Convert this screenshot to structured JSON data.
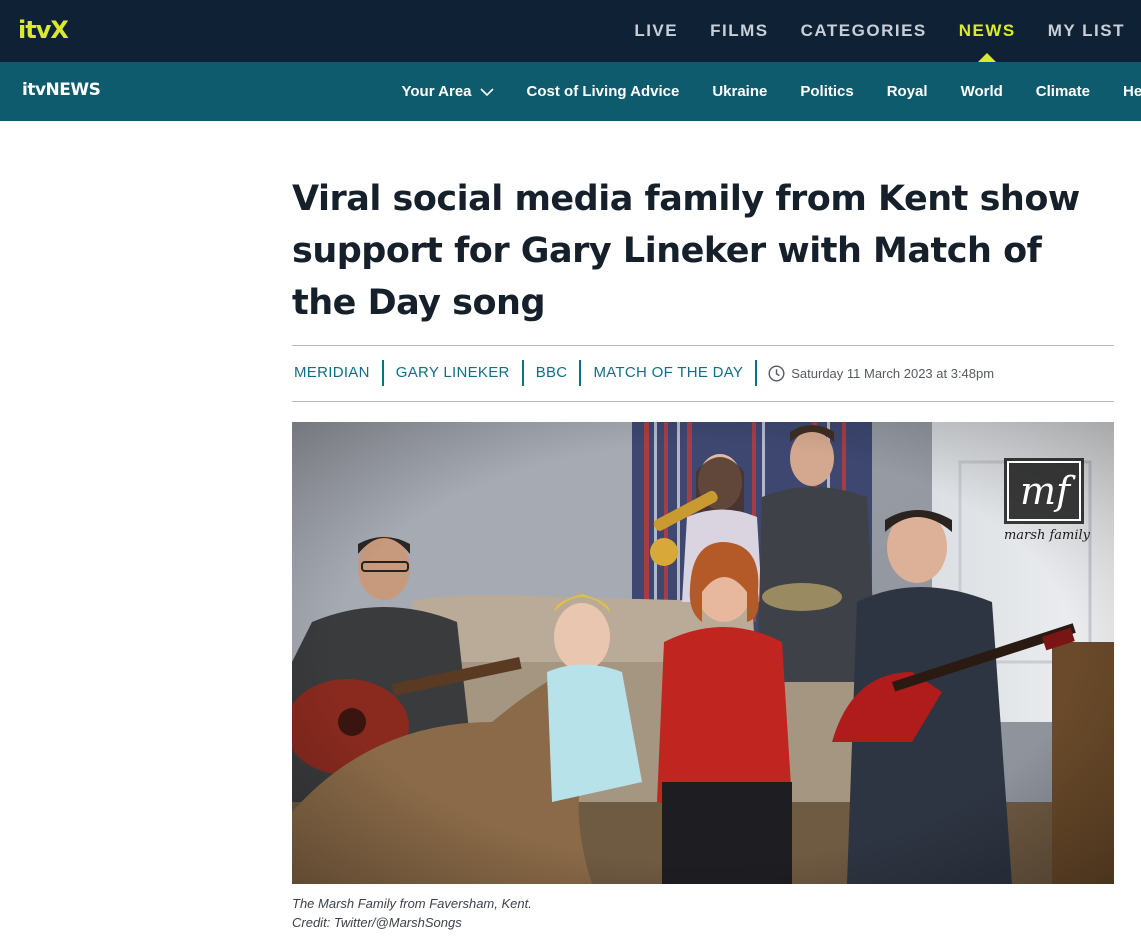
{
  "topbar": {
    "logo": "itvX",
    "nav": [
      "LIVE",
      "FILMS",
      "CATEGORIES",
      "NEWS",
      "MY LIST"
    ],
    "active": "NEWS",
    "accent_color": "#dce92f",
    "bg_color": "#0f2235"
  },
  "newsbar": {
    "logo_itv": "itv",
    "logo_news": "NEWS",
    "nav": [
      "Your Area",
      "Cost of Living Advice",
      "Ukraine",
      "Politics",
      "Royal",
      "World",
      "Climate",
      "Health"
    ],
    "bg_color": "#0e5b6e"
  },
  "article": {
    "headline": "Viral social media family from Kent show support for Gary Lineker with Match of the Day song",
    "tags": [
      "MERIDIAN",
      "GARY LINEKER",
      "BBC",
      "MATCH OF THE DAY"
    ],
    "date": "Saturday 11 March 2023 at 3:48pm",
    "watermark_text": "mf",
    "watermark_sub": "marsh family",
    "caption_line1": "The Marsh Family from Faversham, Kent.",
    "caption_line2": "Credit: Twitter/@MarshSongs"
  }
}
